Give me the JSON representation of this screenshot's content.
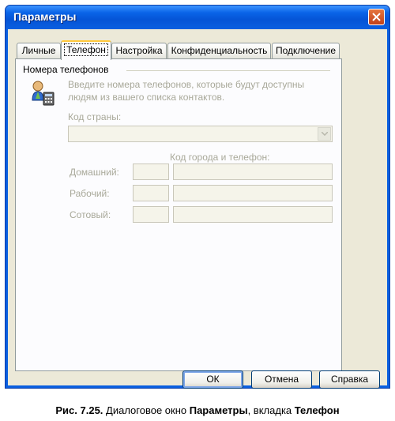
{
  "window": {
    "title": "Параметры"
  },
  "tabs": [
    {
      "label": "Личные"
    },
    {
      "label": "Телефон"
    },
    {
      "label": "Настройка"
    },
    {
      "label": "Конфиденциальность"
    },
    {
      "label": "Подключение"
    }
  ],
  "group": {
    "title": "Номера телефонов",
    "hint": "Введите номера телефонов, которые будут доступны людям из вашего списка контактов.",
    "country_label": "Код страны:",
    "country_value": "",
    "city_phone_header": "Код города и телефон:",
    "rows": [
      {
        "label": "Домашний:",
        "code": "",
        "phone": ""
      },
      {
        "label": "Рабочий:",
        "code": "",
        "phone": ""
      },
      {
        "label": "Сотовый:",
        "code": "",
        "phone": ""
      }
    ]
  },
  "buttons": {
    "ok": "ОК",
    "cancel": "Отмена",
    "help": "Справка"
  },
  "caption": {
    "fig": "Рис. 7.25.",
    "t1": " Диалоговое окно ",
    "b1": "Параметры",
    "t2": ", вкладка ",
    "b2": "Телефон"
  }
}
